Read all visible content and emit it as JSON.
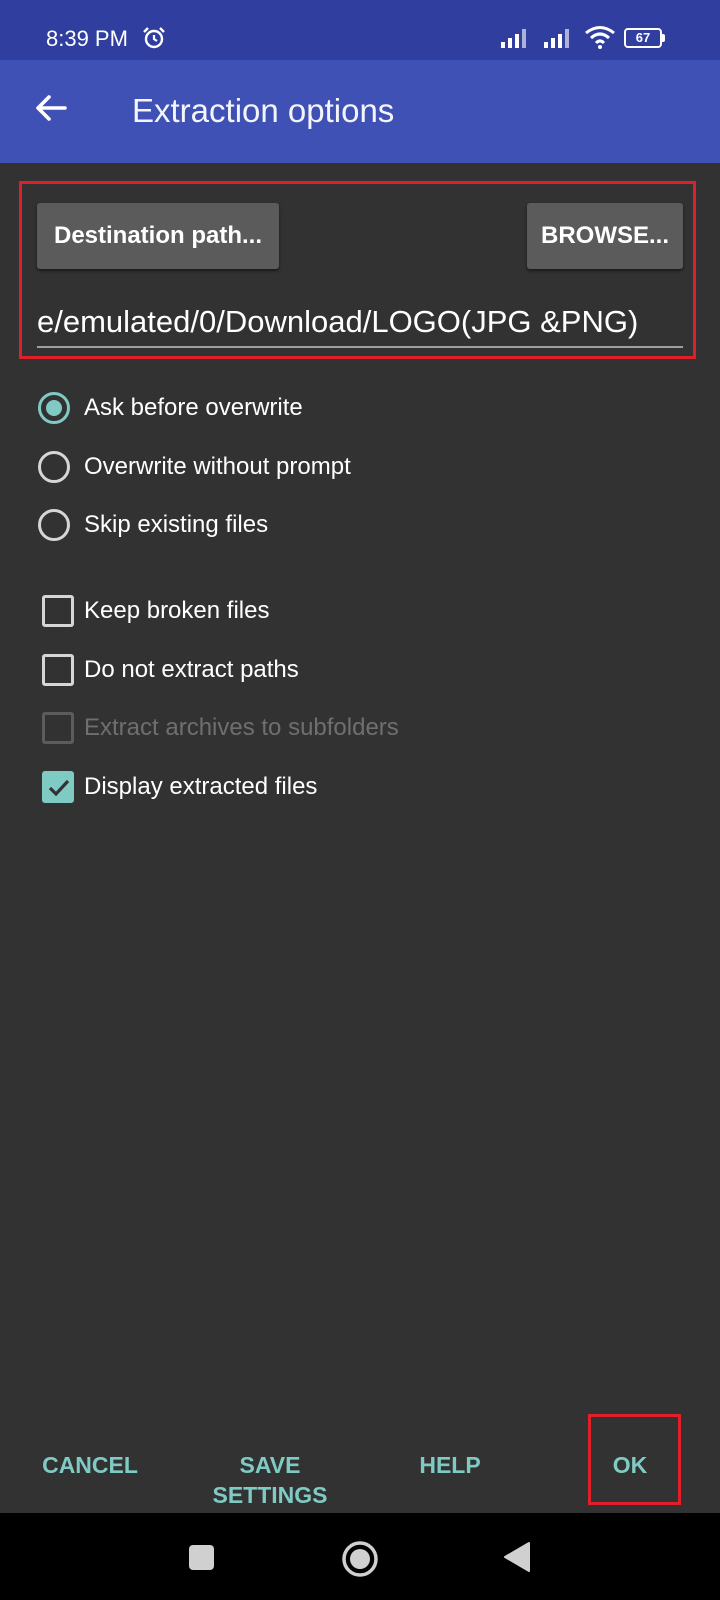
{
  "status_bar": {
    "time": "8:39 PM",
    "battery": "67"
  },
  "app_bar": {
    "title": "Extraction options"
  },
  "destination": {
    "path_button_label": "Destination path...",
    "browse_button_label": "BROWSE...",
    "path_value": "e/emulated/0/Download/LOGO(JPG &PNG)"
  },
  "overwrite_options": [
    {
      "label": "Ask before overwrite",
      "selected": true
    },
    {
      "label": "Overwrite without prompt",
      "selected": false
    },
    {
      "label": "Skip existing files",
      "selected": false
    }
  ],
  "checkbox_options": [
    {
      "label": "Keep broken files",
      "checked": false,
      "enabled": true
    },
    {
      "label": "Do not extract paths",
      "checked": false,
      "enabled": true
    },
    {
      "label": "Extract archives to subfolders",
      "checked": false,
      "enabled": false
    },
    {
      "label": "Display extracted files",
      "checked": true,
      "enabled": true
    }
  ],
  "actions": {
    "cancel": "CANCEL",
    "save_settings_line1": "SAVE",
    "save_settings_line2": "SETTINGS",
    "help": "HELP",
    "ok": "OK"
  },
  "colors": {
    "status_bar": "#303f9f",
    "app_bar": "#3f51b5",
    "background": "#323232",
    "accent": "#7fcbc4",
    "highlight_border": "#e01f2b"
  }
}
